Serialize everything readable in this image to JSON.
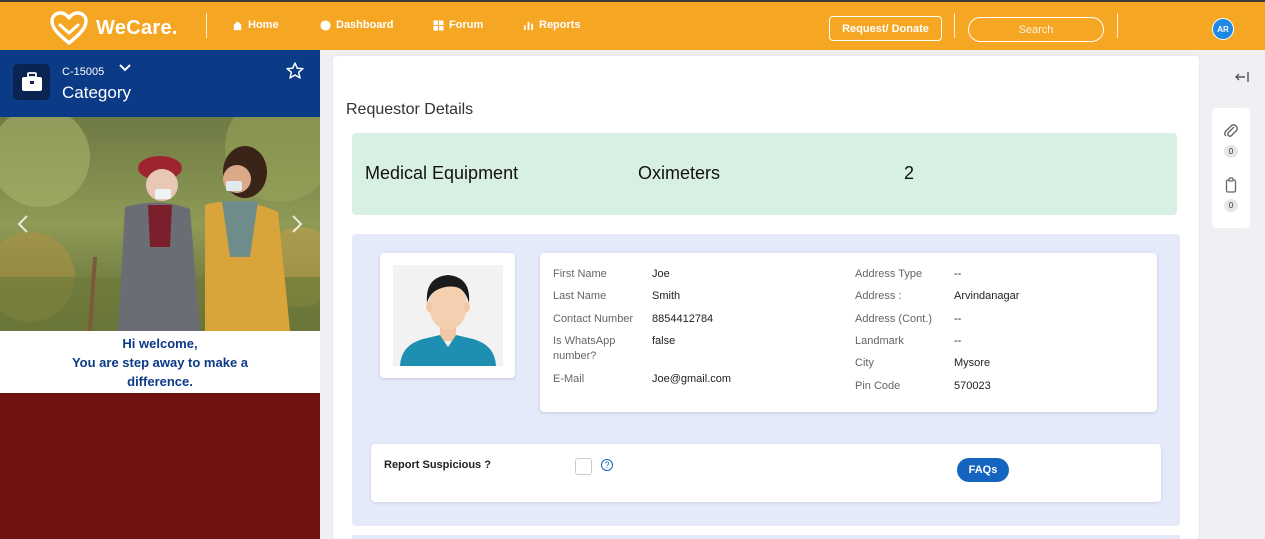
{
  "app": {
    "name": "WeCare."
  },
  "nav": [
    {
      "label": "Home",
      "icon": "home-icon"
    },
    {
      "label": "Dashboard",
      "icon": "dashboard-icon"
    },
    {
      "label": "Forum",
      "icon": "forum-icon"
    },
    {
      "label": "Reports",
      "icon": "reports-icon"
    }
  ],
  "header": {
    "request_label": "Request/ Donate",
    "search_placeholder": "Search",
    "user_initials": "AR"
  },
  "case": {
    "id": "C-15005",
    "category": "Category"
  },
  "welcome": {
    "line1": "Hi welcome,",
    "line2": "You are step away to make a",
    "line3": "difference."
  },
  "requestor": {
    "title": "Requestor Details",
    "summary": {
      "category": "Medical Equipment",
      "item": "Oximeters",
      "quantity": "2"
    },
    "fields_left": [
      {
        "label": "First Name",
        "value": "Joe"
      },
      {
        "label": "Last Name",
        "value": "Smith"
      },
      {
        "label": "Contact Number",
        "value": "8854412784"
      },
      {
        "label": "Is WhatsApp number?",
        "value": "false"
      },
      {
        "label": "E-Mail",
        "value": "Joe@gmail.com"
      }
    ],
    "fields_right": [
      {
        "label": "Address Type",
        "value": "--"
      },
      {
        "label": "Address :",
        "value": "Arvindanagar"
      },
      {
        "label": "Address (Cont.)",
        "value": "--"
      },
      {
        "label": "Landmark",
        "value": "--"
      },
      {
        "label": "City",
        "value": "Mysore"
      },
      {
        "label": "Pin Code",
        "value": "570023"
      }
    ],
    "report_label": "Report Suspicious ?",
    "faq_label": "FAQs"
  },
  "rail": {
    "attachments_count": "0",
    "clipboard_count": "0"
  },
  "colors": {
    "header": "#f5a623",
    "left_header": "#0b3a86",
    "left_panel": "#6e1310",
    "summary_bg": "#d8f0e3",
    "details_bg": "#e5eafb",
    "button": "#1565c0"
  }
}
